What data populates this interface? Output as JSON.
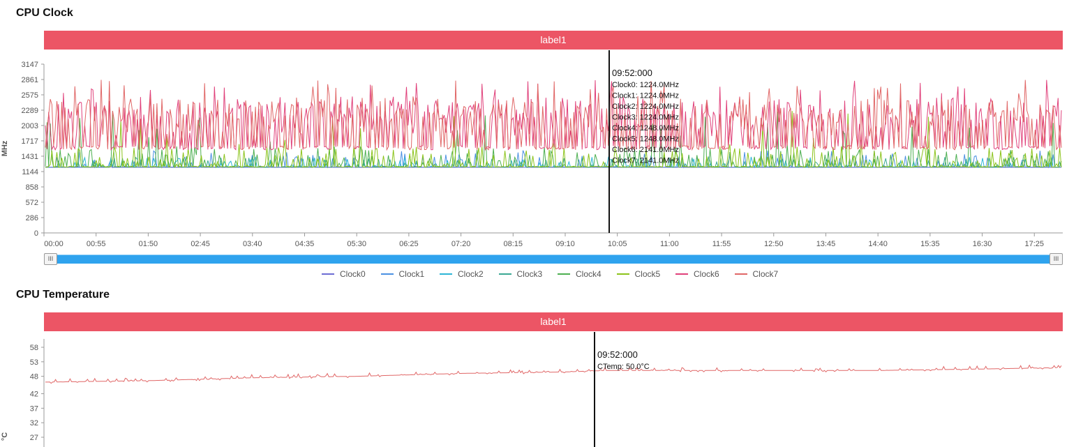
{
  "clock_section": {
    "title": "CPU Clock",
    "label_bar": "label1",
    "y_unit": "MHz",
    "y_ticks": [
      "0",
      "286",
      "572",
      "858",
      "1144",
      "1431",
      "1717",
      "2003",
      "2289",
      "2575",
      "2861",
      "3147"
    ],
    "x_ticks": [
      "00:00",
      "00:55",
      "01:50",
      "02:45",
      "03:40",
      "04:35",
      "05:30",
      "06:25",
      "07:20",
      "08:15",
      "09:10",
      "10:05",
      "11:00",
      "11:55",
      "12:50",
      "13:45",
      "14:40",
      "15:35",
      "16:30",
      "17:25"
    ],
    "tooltip": {
      "time": "09:52:000",
      "lines": [
        "Clock0: 1224.0MHz",
        "Clock1: 1224.0MHz",
        "Clock2: 1224.0MHz",
        "Clock3: 1224.0MHz",
        "Clock4: 1248.0MHz",
        "Clock5: 1248.0MHz",
        "Clock6: 2141.0MHz",
        "Clock7: 2141.0MHz"
      ]
    },
    "slider": {
      "start_grip": "III",
      "end_grip": "III"
    },
    "legend": [
      {
        "name": "Clock0",
        "color": "#6c6cd4"
      },
      {
        "name": "Clock1",
        "color": "#4a90e2"
      },
      {
        "name": "Clock2",
        "color": "#2cb5d6"
      },
      {
        "name": "Clock3",
        "color": "#3aa893"
      },
      {
        "name": "Clock4",
        "color": "#4caf50"
      },
      {
        "name": "Clock5",
        "color": "#8bc31a"
      },
      {
        "name": "Clock6",
        "color": "#e0407a"
      },
      {
        "name": "Clock7",
        "color": "#e06666"
      }
    ]
  },
  "temp_section": {
    "title": "CPU Temperature",
    "label_bar": "label1",
    "y_unit": "°C",
    "y_ticks": [
      "27",
      "32",
      "37",
      "42",
      "48",
      "53",
      "58"
    ],
    "tooltip": {
      "time": "09:52:000",
      "lines": [
        "CTemp: 50.0°C"
      ]
    }
  },
  "chart_data": [
    {
      "type": "line",
      "title": "CPU Clock",
      "ylabel": "MHz",
      "ylim": [
        0,
        3147
      ],
      "xlim": [
        "00:00",
        "17:55"
      ],
      "x_ticks": [
        "00:00",
        "00:55",
        "01:50",
        "02:45",
        "03:40",
        "04:35",
        "05:30",
        "06:25",
        "07:20",
        "08:15",
        "09:10",
        "10:05",
        "11:00",
        "11:55",
        "12:50",
        "13:45",
        "14:40",
        "15:35",
        "16:30",
        "17:25"
      ],
      "cursor_time": "09:52",
      "series": [
        {
          "name": "Clock0",
          "color": "#6c6cd4",
          "baseline": 1224,
          "peak": 1248,
          "value_at_cursor": 1224.0
        },
        {
          "name": "Clock1",
          "color": "#4a90e2",
          "baseline": 1224,
          "peak": 1750,
          "value_at_cursor": 1224.0
        },
        {
          "name": "Clock2",
          "color": "#2cb5d6",
          "baseline": 1224,
          "peak": 1550,
          "value_at_cursor": 1224.0
        },
        {
          "name": "Clock3",
          "color": "#3aa893",
          "baseline": 1224,
          "peak": 1550,
          "value_at_cursor": 1224.0
        },
        {
          "name": "Clock4",
          "color": "#4caf50",
          "baseline": 1224,
          "peak": 2289,
          "value_at_cursor": 1248.0
        },
        {
          "name": "Clock5",
          "color": "#8bc31a",
          "baseline": 1224,
          "peak": 2289,
          "value_at_cursor": 1248.0
        },
        {
          "name": "Clock6",
          "color": "#e0407a",
          "baseline": 1550,
          "peak": 2861,
          "value_at_cursor": 2141.0
        },
        {
          "name": "Clock7",
          "color": "#e06666",
          "baseline": 1550,
          "peak": 2861,
          "value_at_cursor": 2141.0
        }
      ],
      "legend_position": "bottom",
      "grid": false
    },
    {
      "type": "line",
      "title": "CPU Temperature",
      "ylabel": "°C",
      "ylim": [
        27,
        58
      ],
      "cursor_time": "09:52",
      "series": [
        {
          "name": "CTemp",
          "color": "#e06666",
          "x": [
            "00:00",
            "01:50",
            "03:40",
            "05:30",
            "07:20",
            "09:10",
            "09:52",
            "11:00",
            "12:50",
            "14:40",
            "16:30",
            "17:55"
          ],
          "values": [
            46,
            46.5,
            47.5,
            48,
            49,
            49.5,
            50.0,
            50,
            50,
            50,
            50.5,
            51
          ]
        }
      ],
      "grid": false
    }
  ]
}
